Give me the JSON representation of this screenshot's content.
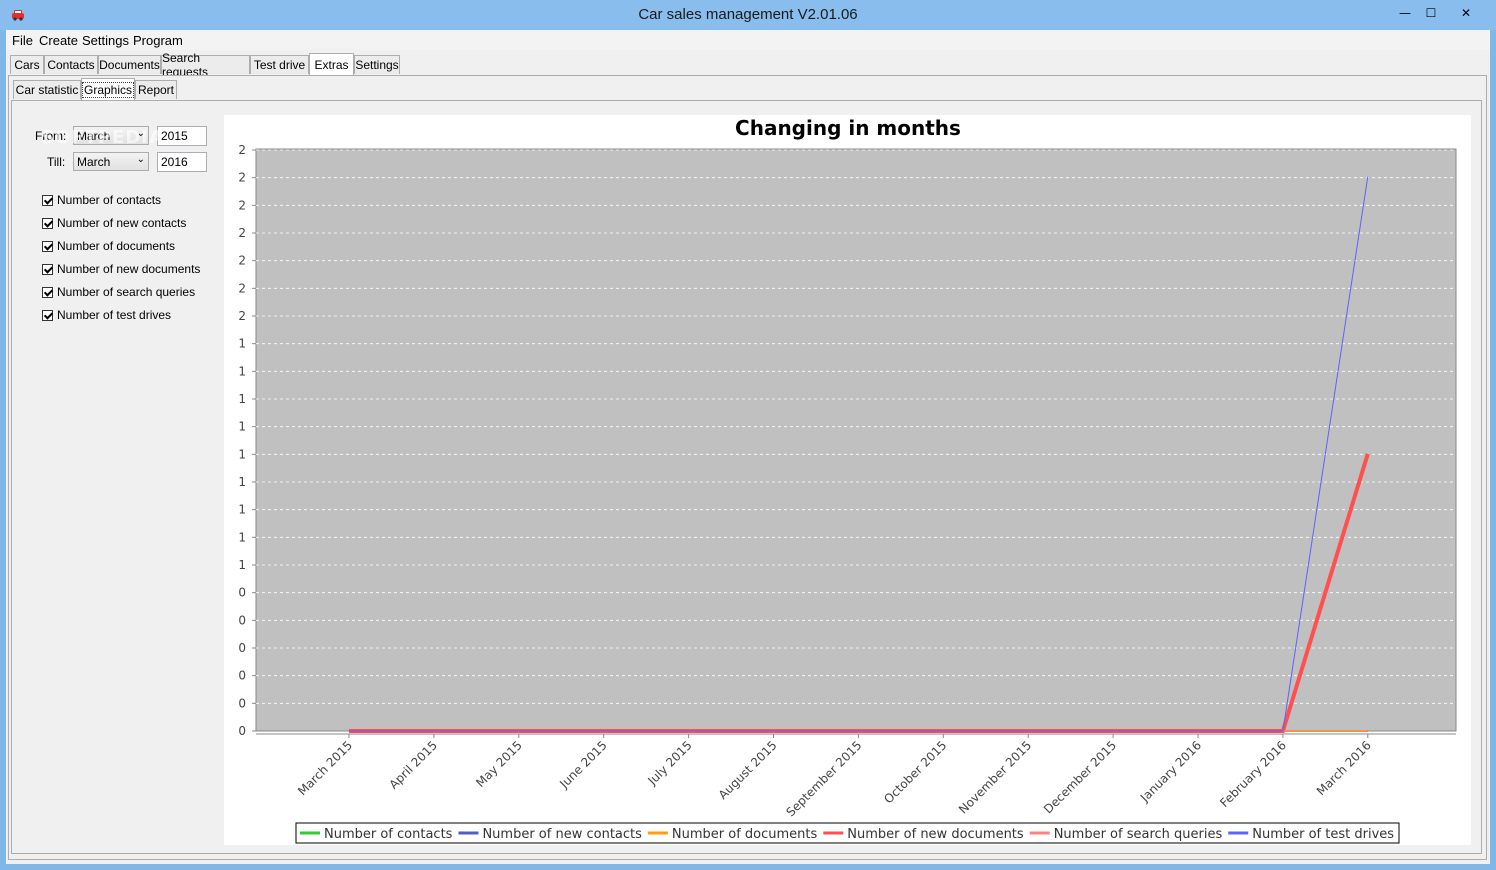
{
  "window": {
    "title": "Car sales management V2.01.06",
    "minimize_label": "—",
    "maximize_label": "☐",
    "close_label": "✕"
  },
  "menu": [
    "File",
    "Create",
    "Settings",
    "Program"
  ],
  "main_tabs": [
    "Cars",
    "Contacts",
    "Documents",
    "Search requests",
    "Test drive",
    "Extras",
    "Settings"
  ],
  "active_main_tab": "Extras",
  "sub_tabs": [
    "Car statistic",
    "Graphics",
    "Report"
  ],
  "active_sub_tab": "Graphics",
  "filters": {
    "from_label": "From:",
    "from_month": "March",
    "from_year": "2015",
    "till_label": "Till:",
    "till_month": "March",
    "till_year": "2016"
  },
  "checkboxes": [
    {
      "label": "Number of contacts",
      "checked": true
    },
    {
      "label": "Number of new contacts",
      "checked": true
    },
    {
      "label": "Number of documents",
      "checked": true
    },
    {
      "label": "Number of new documents",
      "checked": true
    },
    {
      "label": "Number of search queries",
      "checked": true
    },
    {
      "label": "Number of test drives",
      "checked": true
    }
  ],
  "watermark": "SOFTPEDIA",
  "chart_data": {
    "type": "line",
    "title": "Changing in months",
    "categories": [
      "March 2015",
      "April 2015",
      "May 2015",
      "June 2015",
      "July 2015",
      "August 2015",
      "September 2015",
      "October 2015",
      "November 2015",
      "December 2015",
      "January 2016",
      "February 2016",
      "March 2016"
    ],
    "y_tick_labels": [
      "0",
      "0",
      "0",
      "0",
      "0",
      "0",
      "1",
      "1",
      "1",
      "1",
      "1",
      "1",
      "1",
      "1",
      "1",
      "2",
      "2",
      "2",
      "2",
      "2",
      "2",
      "2"
    ],
    "ylim": [
      0,
      2.1
    ],
    "grid": true,
    "plot_background": "#c0c0c0",
    "legend_position": "bottom",
    "series": [
      {
        "name": "Number of contacts",
        "color": "#33cc33",
        "values": [
          0,
          0,
          0,
          0,
          0,
          0,
          0,
          0,
          0,
          0,
          0,
          0,
          0
        ]
      },
      {
        "name": "Number of new contacts",
        "color": "#4f5fbf",
        "values": [
          0,
          0,
          0,
          0,
          0,
          0,
          0,
          0,
          0,
          0,
          0,
          0,
          0
        ]
      },
      {
        "name": "Number of documents",
        "color": "#ff9a1a",
        "values": [
          0,
          0,
          0,
          0,
          0,
          0,
          0,
          0,
          0,
          0,
          0,
          0,
          0
        ]
      },
      {
        "name": "Number of new documents",
        "color": "#ff5050",
        "values": [
          0,
          0,
          0,
          0,
          0,
          0,
          0,
          0,
          0,
          0,
          0,
          0,
          1
        ]
      },
      {
        "name": "Number of search queries",
        "color": "#ff8080",
        "values": [
          0,
          0,
          0,
          0,
          0,
          0,
          0,
          0,
          0,
          0,
          0,
          0,
          0
        ]
      },
      {
        "name": "Number of test drives",
        "color": "#6060ff",
        "values": [
          0,
          0,
          0,
          0,
          0,
          0,
          0,
          0,
          0,
          0,
          0,
          0,
          2
        ]
      }
    ]
  }
}
